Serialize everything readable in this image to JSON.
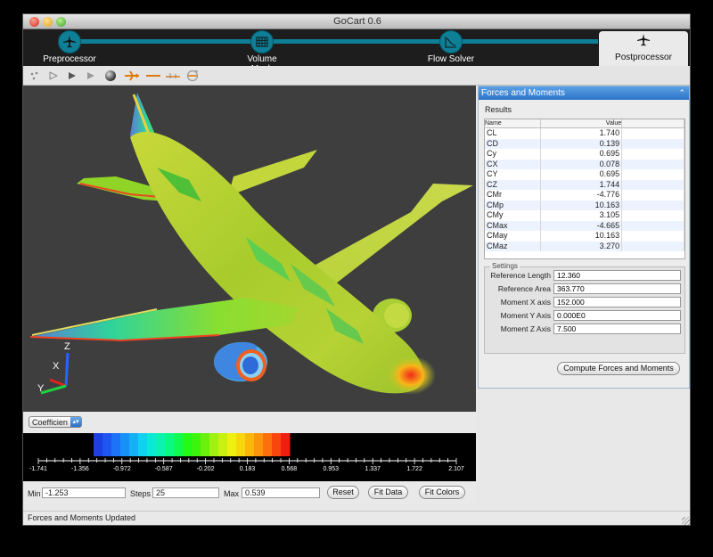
{
  "window": {
    "title": "GoCart 0.6"
  },
  "wizard": {
    "steps": [
      {
        "label": "Preprocessor",
        "icon": "airplane-icon"
      },
      {
        "label": "Volume Mesh",
        "icon": "mesh-grid-icon"
      },
      {
        "label": "Flow Solver",
        "icon": "flow-chart-icon"
      }
    ],
    "active": {
      "label": "Postprocessor",
      "icon": "airplane-icon"
    }
  },
  "toolbar": {
    "icons": [
      "dots-icon",
      "play-outline-icon",
      "play-icon",
      "step-icon",
      "sphere-icon",
      "aircraft-view-icon",
      "line-icon",
      "slice-icon",
      "rotate-icon"
    ]
  },
  "axes": {
    "z": "Z",
    "x": "X",
    "y": "Y"
  },
  "panel": {
    "title": "Forces and Moments",
    "results_title": "Results",
    "columns": [
      "Name",
      "Value",
      ""
    ],
    "results": [
      {
        "name": "CL",
        "value": "1.740"
      },
      {
        "name": "CD",
        "value": "0.139"
      },
      {
        "name": "Cy",
        "value": "0.695"
      },
      {
        "name": "CX",
        "value": "0.078"
      },
      {
        "name": "CY",
        "value": "0.695"
      },
      {
        "name": "CZ",
        "value": "1.744"
      },
      {
        "name": "CMr",
        "value": "-4.776"
      },
      {
        "name": "CMp",
        "value": "10.163"
      },
      {
        "name": "CMy",
        "value": "3.105"
      },
      {
        "name": "CMax",
        "value": "-4.665"
      },
      {
        "name": "CMay",
        "value": "10.163"
      },
      {
        "name": "CMaz",
        "value": "3.270"
      }
    ],
    "settings_title": "Settings",
    "settings": [
      {
        "label": "Reference Length",
        "value": "12.360"
      },
      {
        "label": "Reference Area",
        "value": "363.770"
      },
      {
        "label": "Moment X axis",
        "value": "152.000"
      },
      {
        "label": "Moment Y Axis",
        "value": "0.000E0"
      },
      {
        "label": "Moment Z Axis",
        "value": "7.500"
      }
    ],
    "compute_label": "Compute Forces and Moments"
  },
  "colormap": {
    "variable": "Coefficien",
    "ticks": [
      "-1.741",
      "-1.356",
      "-0.972",
      "-0.587",
      "-0.202",
      "0.183",
      "0.568",
      "0.953",
      "1.337",
      "1.722",
      "2.107"
    ],
    "bands": [
      "#1d3fe0",
      "#1f55f0",
      "#1d72f8",
      "#1790f7",
      "#16b0f5",
      "#0fd2f0",
      "#0ae9d6",
      "#0af4b0",
      "#0af884",
      "#10fa50",
      "#23fa18",
      "#3cf50e",
      "#6af00c",
      "#a0f010",
      "#c8f010",
      "#eef010",
      "#f8d60c",
      "#fbb60c",
      "#fc940c",
      "#fb700c",
      "#f8460c",
      "#f01e10"
    ]
  },
  "range": {
    "min_label": "Min",
    "min_value": "-1.253",
    "steps_label": "Steps",
    "steps_value": "25",
    "max_label": "Max",
    "max_value": "0.539",
    "reset_label": "Reset",
    "fit_data_label": "Fit Data",
    "fit_colors_label": "Fit Colors"
  },
  "status": {
    "text": "Forces and Moments Updated"
  }
}
